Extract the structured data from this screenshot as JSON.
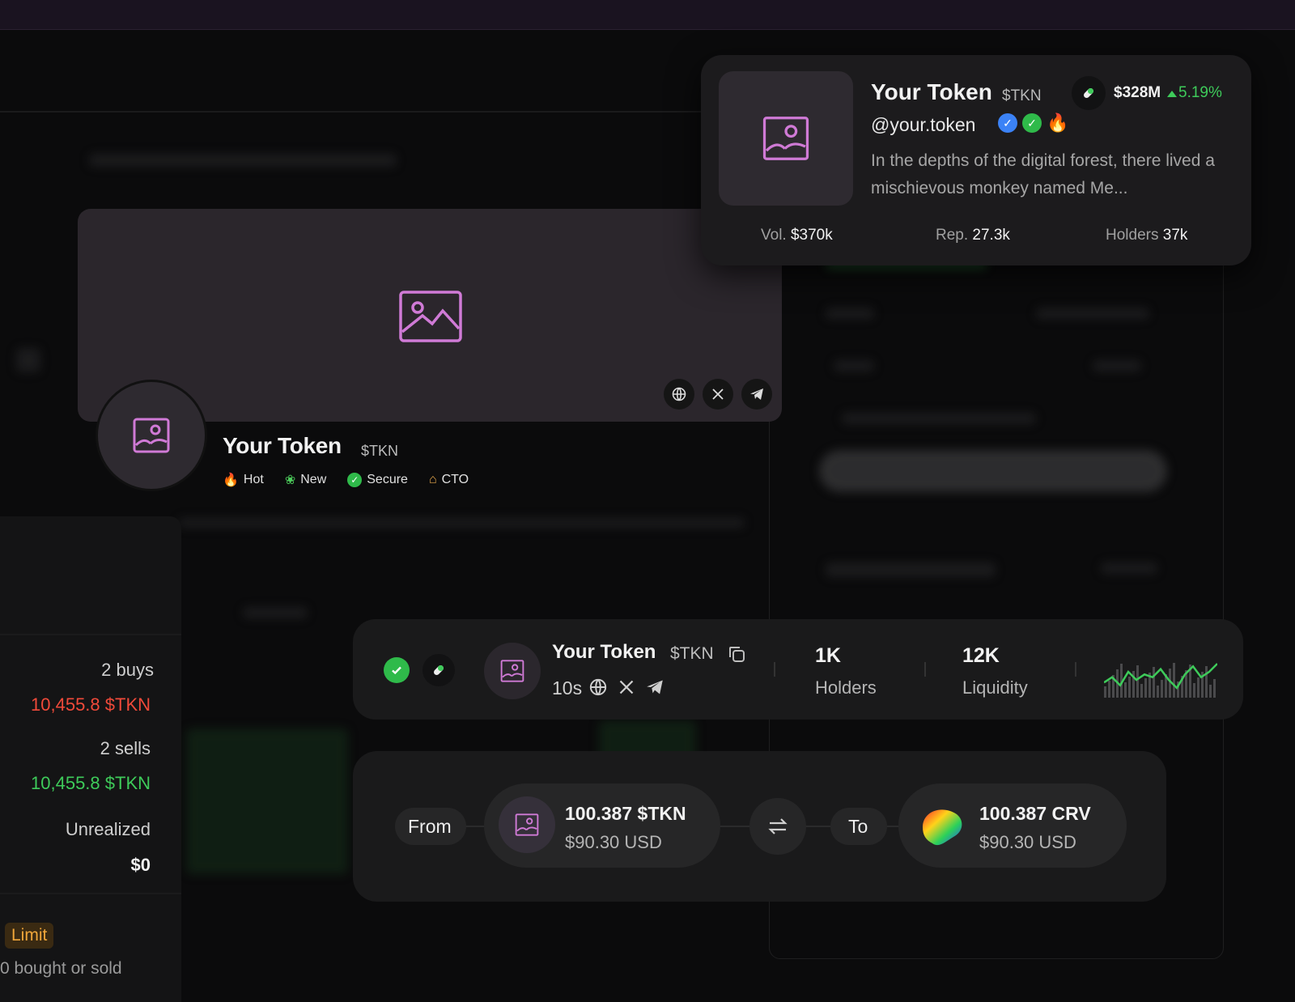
{
  "banner": {
    "token_name": "Your Token",
    "ticker": "$TKN",
    "tags": [
      {
        "icon": "fire-icon",
        "label": "Hot"
      },
      {
        "icon": "clover-icon",
        "label": "New"
      },
      {
        "icon": "check-shield-icon",
        "label": "Secure"
      },
      {
        "icon": "house-icon",
        "label": "CTO"
      }
    ],
    "socials": [
      "globe-icon",
      "x-icon",
      "telegram-icon"
    ]
  },
  "popup": {
    "token_name": "Your Token",
    "ticker": "$TKN",
    "market_cap": "$328M",
    "change": "5.19%",
    "handle": "@your.token",
    "description": "In the depths of the digital forest, there lived a mischievous monkey named Me...",
    "stats": [
      {
        "label": "Vol.",
        "value": "$370k"
      },
      {
        "label": "Rep.",
        "value": "27.3k"
      },
      {
        "label": "Holders",
        "value": "37k"
      }
    ],
    "colors": {
      "positive": "#3ecb5a",
      "verified": "#3b82f6"
    }
  },
  "left_panel": {
    "buys_label": "2 buys",
    "buys_amount": "10,455.8 $TKN",
    "sells_label": "2 sells",
    "sells_amount": "10,455.8 $TKN",
    "unrealized_label": "Unrealized",
    "unrealized_value": "$0",
    "limit_label": "Limit",
    "footer_text": "0 bought or sold",
    "colors": {
      "buy": "#f04a3a",
      "sell": "#3ecb5a",
      "limit": "#f0a63a"
    }
  },
  "token_row": {
    "token_name": "Your Token",
    "ticker": "$TKN",
    "age": "10s",
    "holders_value": "1K",
    "holders_label": "Holders",
    "liquidity_value": "12K",
    "liquidity_label": "Liquidity",
    "sparkline": [
      5,
      7,
      4,
      9,
      6,
      8,
      7,
      10,
      6,
      3,
      8,
      11,
      7,
      9,
      12
    ]
  },
  "swap": {
    "from_label": "From",
    "from_amount": "100.387 $TKN",
    "from_usd": "$90.30 USD",
    "to_label": "To",
    "to_amount": "100.387 CRV",
    "to_usd": "$90.30 USD"
  }
}
